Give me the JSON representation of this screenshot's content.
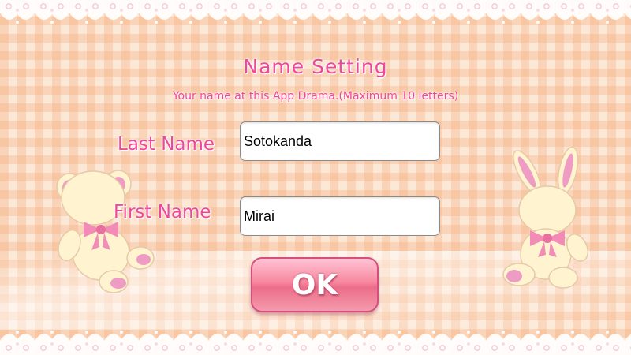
{
  "dialog": {
    "title": "Name Setting",
    "subtitle": "Your name at this App Drama.(Maximum 10 letters)"
  },
  "form": {
    "last_name_label": "Last Name",
    "last_name_value": "Sotokanda",
    "first_name_label": "First Name",
    "first_name_value": "Mirai",
    "ok_label": "OK"
  },
  "theme": {
    "accent_pink": "#f0479a",
    "button_pink": "#f7889f",
    "background_peach": "#fce8d6",
    "mascot_cream": "#fff4cf",
    "mascot_accent": "#ef9cc4"
  },
  "decorations": {
    "left_mascot": "teddy-bear",
    "right_mascot": "bunny",
    "frame": "lace-border"
  }
}
